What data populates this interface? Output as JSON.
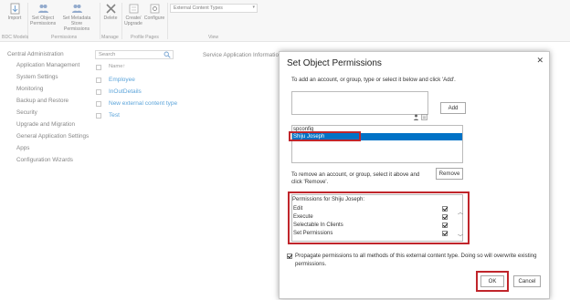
{
  "ribbon": {
    "buttons": [
      {
        "label": "Import",
        "icon": "import-icon"
      },
      {
        "label": "Set Object\nPermissions",
        "icon": "set-object-permissions-icon"
      },
      {
        "label": "Set Metadata Store\nPermissions",
        "icon": "set-metadata-permissions-icon"
      },
      {
        "label": "Delete",
        "icon": "delete-icon"
      },
      {
        "label": "Create/\nUpgrade",
        "icon": "create-upgrade-icon"
      },
      {
        "label": "Configure",
        "icon": "configure-icon"
      }
    ],
    "groups": [
      "BDC Models",
      "Permissions",
      "Manage",
      "Profile Pages",
      "View"
    ],
    "view_select": "External Content Types"
  },
  "left_nav": {
    "title": "Central Administration",
    "items": [
      "Application Management",
      "System Settings",
      "Monitoring",
      "Backup and Restore",
      "Security",
      "Upgrade and Migration",
      "General Application Settings",
      "Apps",
      "Configuration Wizards"
    ]
  },
  "main": {
    "search_placeholder": "Search",
    "service_title": "Service Application Informatio",
    "column_header": "Name↑",
    "rows": [
      "Employee",
      "InOutDetails",
      "New external content type",
      "Test"
    ]
  },
  "dialog": {
    "title": "Set Object Permissions",
    "close": "✕",
    "instruction_add": "To add an account, or group, type or select it below and click 'Add'.",
    "add_label": "Add",
    "users": [
      "spconfig",
      "Shiju Joseph"
    ],
    "selected_user_index": 1,
    "instruction_remove": "To remove an account, or group, select it above and click 'Remove'.",
    "remove_label": "Remove",
    "permissions_title": "Permissions for Shiju Joseph:",
    "permissions": [
      {
        "label": "Edit",
        "checked": true
      },
      {
        "label": "Execute",
        "checked": true
      },
      {
        "label": "Selectable In Clients",
        "checked": true
      },
      {
        "label": "Set Permissions",
        "checked": true
      }
    ],
    "propagate_text": "Propagate permissions to all methods of this external content type. Doing so will overwrite existing permissions.",
    "propagate_checked": true,
    "ok_label": "OK",
    "cancel_label": "Cancel"
  },
  "colors": {
    "accent": "#0072c6",
    "highlight_box": "#c0252b",
    "ribbon_bg": "#f3f3f3"
  }
}
